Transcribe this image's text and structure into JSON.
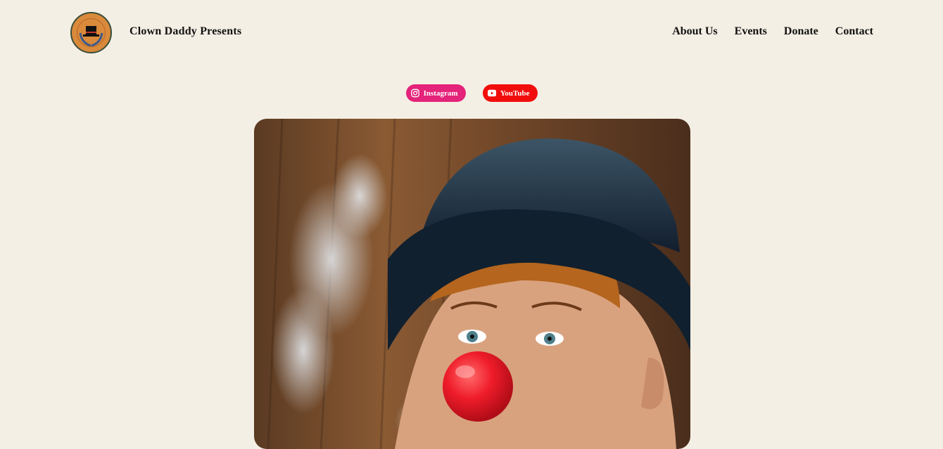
{
  "header": {
    "site_title": "Clown Daddy Presents",
    "nav": [
      "About Us",
      "Events",
      "Donate",
      "Contact"
    ]
  },
  "socials": [
    {
      "label": "Instagram",
      "icon": "instagram-icon",
      "color": "#e4237a"
    },
    {
      "label": "YouTube",
      "icon": "youtube-icon",
      "color": "#f20d0d"
    }
  ],
  "colors": {
    "background": "#f4efe4",
    "text": "#111111"
  },
  "hero": {
    "image": "clown-portrait"
  }
}
